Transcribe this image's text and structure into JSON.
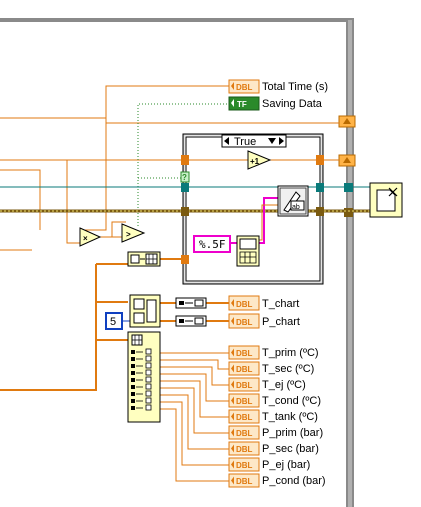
{
  "case_structure": {
    "selector_value": "True"
  },
  "constants": {
    "format_string": "%.5F",
    "numeric_five": "5"
  },
  "indicators": {
    "total_time": {
      "type": "DBL",
      "label": "Total Time (s)"
    },
    "saving_data": {
      "type": "TF",
      "label": "Saving Data"
    },
    "t_chart": {
      "type": "DBL",
      "label": "T_chart"
    },
    "p_chart": {
      "type": "DBL",
      "label": "P_chart"
    },
    "channels": [
      {
        "type": "DBL",
        "label": "T_prim (ºC)"
      },
      {
        "type": "DBL",
        "label": "T_sec (ºC)"
      },
      {
        "type": "DBL",
        "label": "T_ej (ºC)"
      },
      {
        "type": "DBL",
        "label": "T_cond (ºC)"
      },
      {
        "type": "DBL",
        "label": "T_tank (ºC)"
      },
      {
        "type": "DBL",
        "label": "P_prim (bar)"
      },
      {
        "type": "DBL",
        "label": "P_sec (bar)"
      },
      {
        "type": "DBL",
        "label": "P_ej (bar)"
      },
      {
        "type": "DBL",
        "label": "P_cond (bar)"
      }
    ]
  },
  "nodes": {
    "increment_symbol": "+1",
    "multiply_symbol": "×",
    "greater_symbol": ">",
    "boolean_tunnel_symbol": "?"
  },
  "colors": {
    "dbl_wire": "#e07a10",
    "bool_wire": "#2a8a2a",
    "cluster_wire": "#7a5a10",
    "refnum_wire": "#0a7a7a",
    "string_wire": "#ee00cc",
    "int_wire": "#1040c0",
    "frame": "#7a7a7a",
    "indicator_fill": "#fde8c8"
  }
}
